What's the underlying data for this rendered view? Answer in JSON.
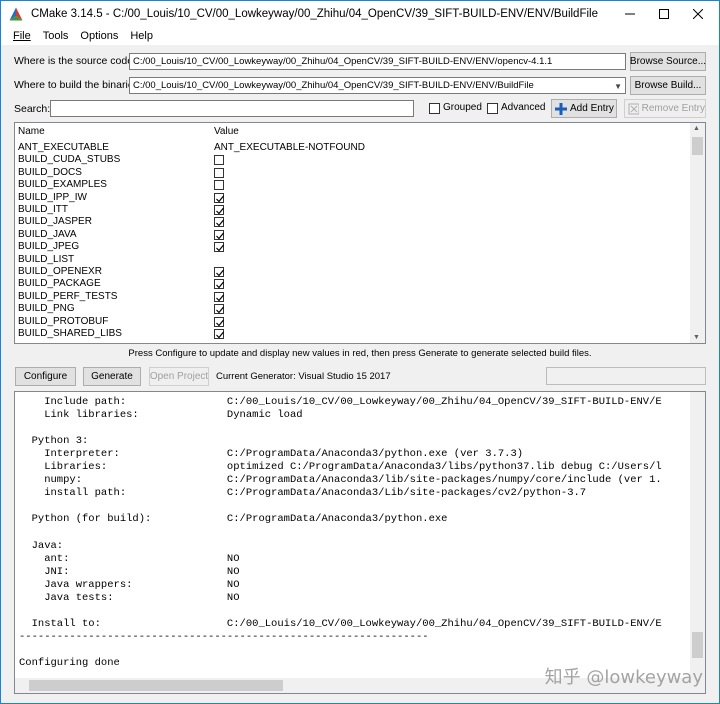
{
  "window": {
    "title": "CMake 3.14.5 - C:/00_Louis/10_CV/00_Lowkeyway/00_Zhihu/04_OpenCV/39_SIFT-BUILD-ENV/ENV/BuildFile",
    "minimize": "—",
    "maximize": "☐",
    "close": "✕"
  },
  "menu": {
    "file": "File",
    "tools": "Tools",
    "options": "Options",
    "help": "Help"
  },
  "source": {
    "label": "Where is the source code:",
    "value": "C:/00_Louis/10_CV/00_Lowkeyway/00_Zhihu/04_OpenCV/39_SIFT-BUILD-ENV/ENV/opencv-4.1.1",
    "browse_button": "Browse Source..."
  },
  "build": {
    "label": "Where to build the binaries:",
    "value": "C:/00_Louis/10_CV/00_Lowkeyway/00_Zhihu/04_OpenCV/39_SIFT-BUILD-ENV/ENV/BuildFile",
    "browse_button": "Browse Build..."
  },
  "search": {
    "label": "Search:",
    "value": "",
    "grouped_label": "Grouped",
    "advanced_label": "Advanced",
    "add_entry": "Add Entry",
    "remove_entry": "Remove Entry"
  },
  "cache_table": {
    "headers": [
      "Name",
      "Value"
    ],
    "rows": [
      {
        "name": "ANT_EXECUTABLE",
        "value": "ANT_EXECUTABLE-NOTFOUND",
        "type": "text"
      },
      {
        "name": "BUILD_CUDA_STUBS",
        "value": "",
        "type": "check",
        "checked": false
      },
      {
        "name": "BUILD_DOCS",
        "value": "",
        "type": "check",
        "checked": false
      },
      {
        "name": "BUILD_EXAMPLES",
        "value": "",
        "type": "check",
        "checked": false
      },
      {
        "name": "BUILD_IPP_IW",
        "value": "",
        "type": "check",
        "checked": true
      },
      {
        "name": "BUILD_ITT",
        "value": "",
        "type": "check",
        "checked": true
      },
      {
        "name": "BUILD_JASPER",
        "value": "",
        "type": "check",
        "checked": true
      },
      {
        "name": "BUILD_JAVA",
        "value": "",
        "type": "check",
        "checked": true
      },
      {
        "name": "BUILD_JPEG",
        "value": "",
        "type": "check",
        "checked": true
      },
      {
        "name": "BUILD_LIST",
        "value": "",
        "type": "text"
      },
      {
        "name": "BUILD_OPENEXR",
        "value": "",
        "type": "check",
        "checked": true
      },
      {
        "name": "BUILD_PACKAGE",
        "value": "",
        "type": "check",
        "checked": true
      },
      {
        "name": "BUILD_PERF_TESTS",
        "value": "",
        "type": "check",
        "checked": true
      },
      {
        "name": "BUILD_PNG",
        "value": "",
        "type": "check",
        "checked": true
      },
      {
        "name": "BUILD_PROTOBUF",
        "value": "",
        "type": "check",
        "checked": true
      },
      {
        "name": "BUILD_SHARED_LIBS",
        "value": "",
        "type": "check",
        "checked": true
      }
    ]
  },
  "hint": "Press Configure to update and display new values in red, then press Generate to generate selected build files.",
  "actions": {
    "configure": "Configure",
    "generate": "Generate",
    "open_project": "Open Project",
    "current_generator": "Current Generator: Visual Studio 15 2017"
  },
  "log": {
    "lines": [
      "    Include path:                C:/00_Louis/10_CV/00_Lowkeyway/00_Zhihu/04_OpenCV/39_SIFT-BUILD-ENV/E",
      "    Link libraries:              Dynamic load",
      "",
      "  Python 3:",
      "    Interpreter:                 C:/ProgramData/Anaconda3/python.exe (ver 3.7.3)",
      "    Libraries:                   optimized C:/ProgramData/Anaconda3/libs/python37.lib debug C:/Users/l",
      "    numpy:                       C:/ProgramData/Anaconda3/lib/site-packages/numpy/core/include (ver 1.",
      "    install path:                C:/ProgramData/Anaconda3/Lib/site-packages/cv2/python-3.7",
      "",
      "  Python (for build):            C:/ProgramData/Anaconda3/python.exe",
      "",
      "  Java:",
      "    ant:                         NO",
      "    JNI:                         NO",
      "    Java wrappers:               NO",
      "    Java tests:                  NO",
      "",
      "  Install to:                    C:/00_Louis/10_CV/00_Lowkeyway/00_Zhihu/04_OpenCV/39_SIFT-BUILD-ENV/E",
      "-----------------------------------------------------------------",
      "",
      "Configuring done"
    ]
  },
  "watermark": "知乎 @lowkeyway"
}
